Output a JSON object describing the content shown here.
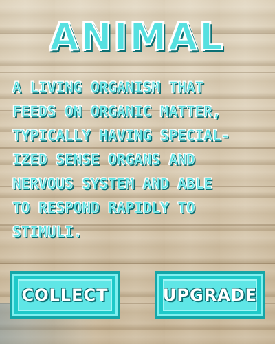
{
  "card": {
    "title": "ANIMAL",
    "description": "A LIVING ORGANISM THAT\nFEEDS ON ORGANIC MATTER,\nTYPICALLY HAVING SPECIAL-\nIZED SENSE ORGANS AND\nNERVOUS SYSTEM AND ABLE\nTO RESPOND RAPIDLY TO\nSTIMULI."
  },
  "buttons": {
    "collect": "COLLECT",
    "upgrade": "UPGRADE"
  },
  "colors": {
    "accent": "#5fe3e3",
    "button_fill": "#1ec9c9",
    "outline_dark": "#0b6f73",
    "wood": "#dccfb5"
  }
}
